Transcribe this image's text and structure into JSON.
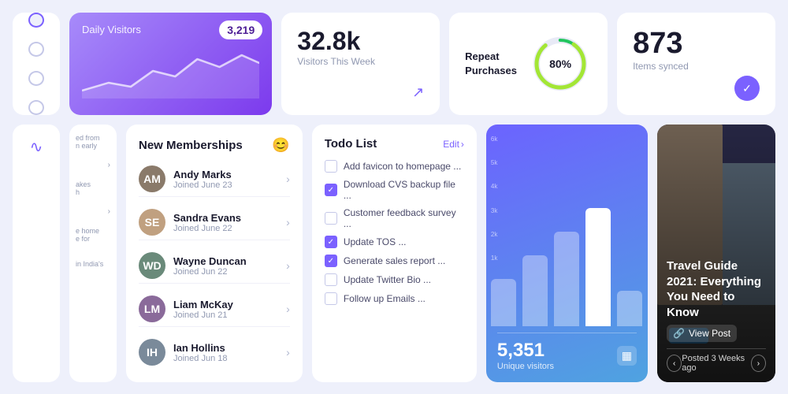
{
  "colors": {
    "accent": "#7b61ff",
    "bg": "#eef0fb",
    "card": "#ffffff",
    "text_dark": "#1a1a2e",
    "text_muted": "#9098b1"
  },
  "top_row": {
    "daily_visitors": {
      "label": "Daily Visitors",
      "badge": "3,219"
    },
    "visitors_week": {
      "number": "32.8k",
      "label": "Visitors This Week"
    },
    "repeat_purchases": {
      "label": "Repeat\nPurchases",
      "percentage": "80%"
    },
    "items_synced": {
      "number": "873",
      "label": "Items synced"
    }
  },
  "memberships": {
    "title": "New Memberships",
    "members": [
      {
        "name": "Andy Marks",
        "date": "Joined June 23",
        "color": "#8a7a6a"
      },
      {
        "name": "Sandra Evans",
        "date": "Joined June 22",
        "color": "#c0a080"
      },
      {
        "name": "Wayne Duncan",
        "date": "Joined Jun 22",
        "color": "#6a8a7a"
      },
      {
        "name": "Liam McKay",
        "date": "Joined Jun 21",
        "color": "#8a6a9a"
      },
      {
        "name": "Ian Hollins",
        "date": "Joined Jun 18",
        "color": "#7a8a9a"
      }
    ]
  },
  "todo": {
    "title": "Todo List",
    "edit_label": "Edit",
    "items": [
      {
        "text": "Add favicon to homepage ...",
        "checked": false
      },
      {
        "text": "Download CVS backup file ...",
        "checked": true
      },
      {
        "text": "Customer feedback survey ...",
        "checked": false
      },
      {
        "text": "Update TOS ...",
        "checked": true
      },
      {
        "text": "Generate sales report ...",
        "checked": true
      },
      {
        "text": "Update Twitter Bio ...",
        "checked": false
      },
      {
        "text": "Follow up Emails ...",
        "checked": false
      }
    ]
  },
  "chart": {
    "bars": [
      {
        "height": 60,
        "label": ""
      },
      {
        "height": 90,
        "label": ""
      },
      {
        "height": 130,
        "label": ""
      },
      {
        "height": 155,
        "label": ""
      },
      {
        "height": 45,
        "label": ""
      }
    ],
    "y_labels": [
      "6k",
      "5k",
      "4k",
      "3k",
      "2k",
      "1k"
    ],
    "unique_visitors": "5,351",
    "unique_label": "Unique visitors"
  },
  "travel": {
    "title": "Travel Guide 2021: Everything You Need to Know",
    "view_post": "View Post",
    "posted": "Posted 3 Weeks ago"
  }
}
